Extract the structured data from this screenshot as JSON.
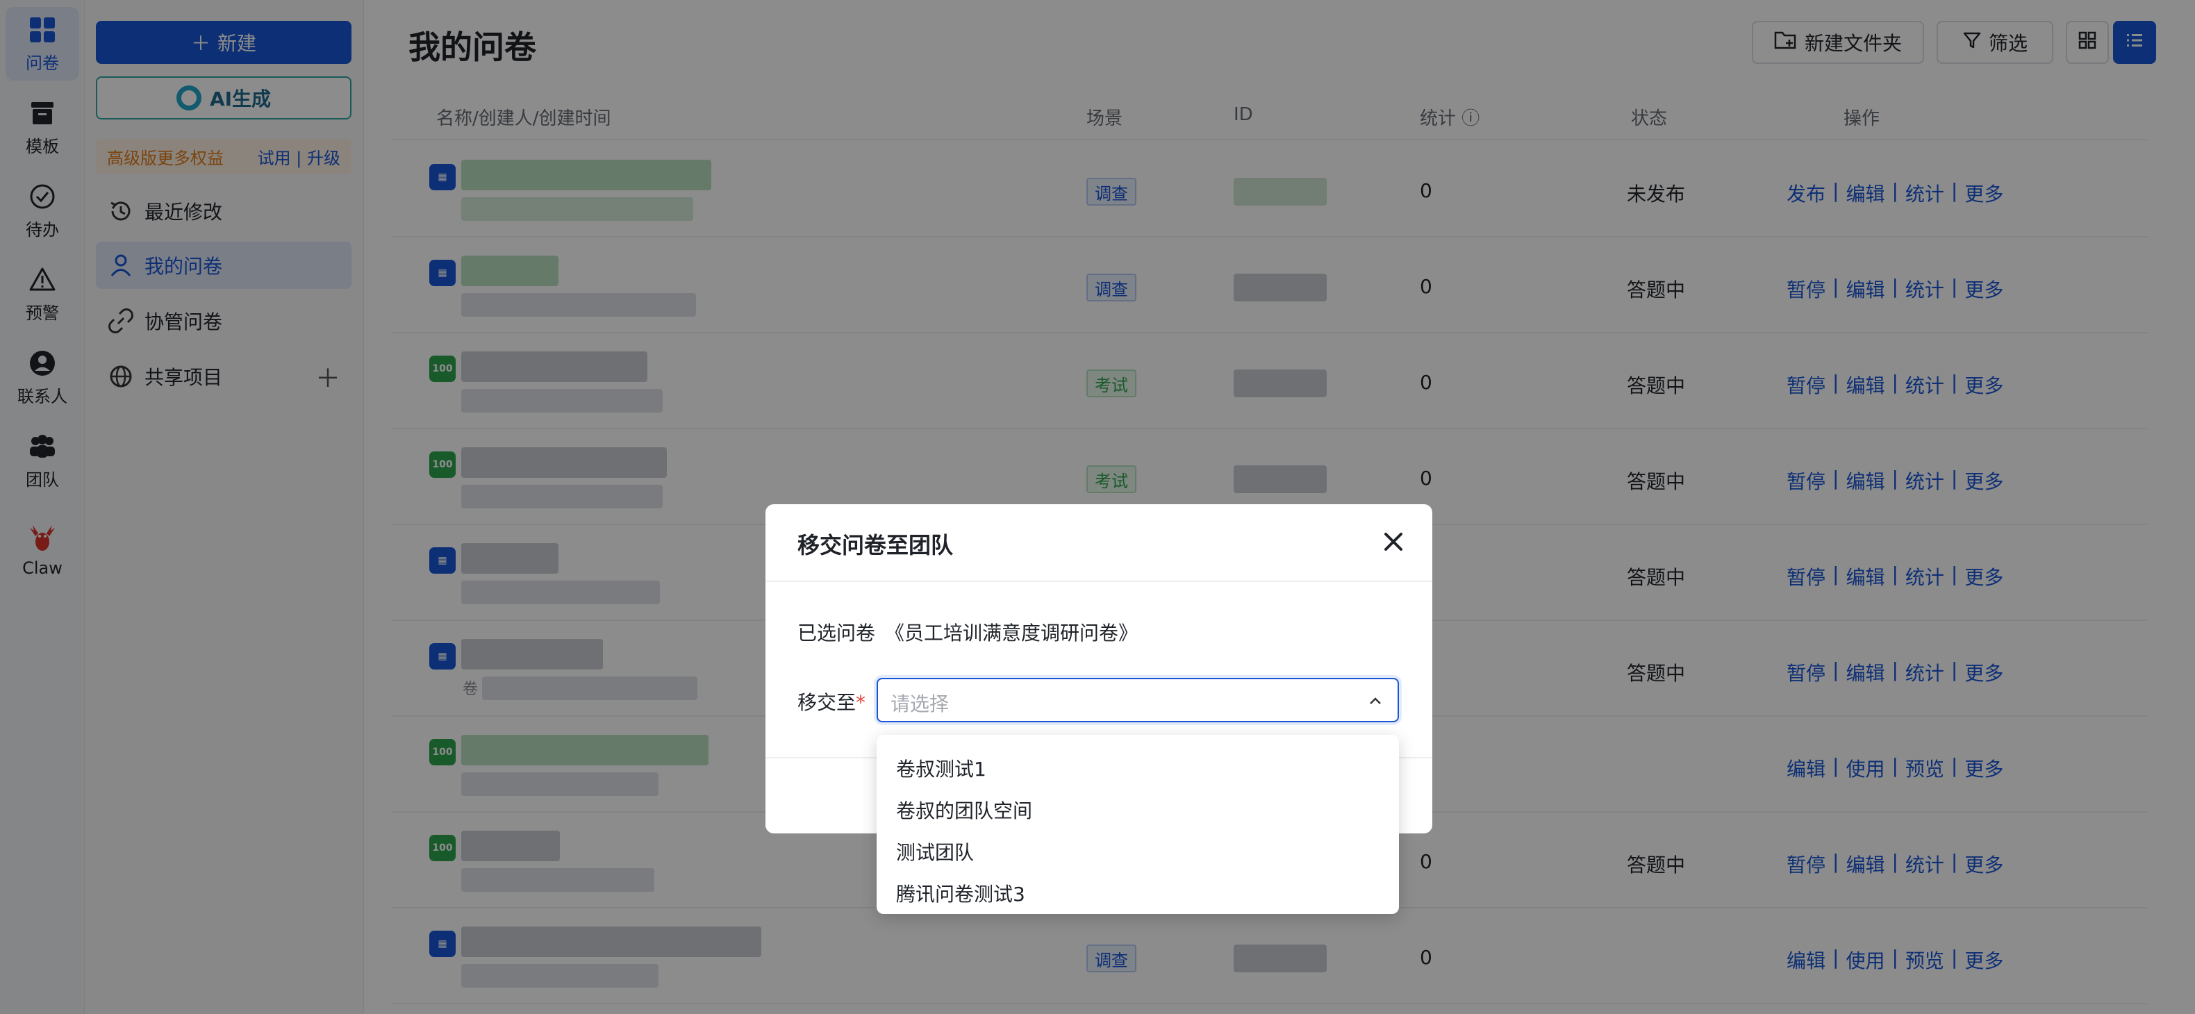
{
  "rail": {
    "items": [
      {
        "label": "问卷",
        "icon": "grid-icon",
        "active": true
      },
      {
        "label": "模板",
        "icon": "archive-icon"
      },
      {
        "label": "待办",
        "icon": "check-circle-icon"
      },
      {
        "label": "预警",
        "icon": "warning-icon"
      },
      {
        "label": "联系人",
        "icon": "contact-icon"
      },
      {
        "label": "团队",
        "icon": "team-icon"
      },
      {
        "label": "Claw",
        "icon": "claw-icon"
      }
    ]
  },
  "sidebar": {
    "new_label": "新建",
    "ai_label": "AI生成",
    "promo_text": "高级版更多权益",
    "promo_links": "试用 | 升级",
    "nav": [
      {
        "label": "最近修改",
        "icon": "history-icon"
      },
      {
        "label": "我的问卷",
        "icon": "user-icon",
        "active": true
      },
      {
        "label": "协管问卷",
        "icon": "link-icon"
      },
      {
        "label": "共享项目",
        "icon": "globe-icon"
      }
    ]
  },
  "main": {
    "title": "我的问卷",
    "toolbar": {
      "new_folder_label": "新建文件夹",
      "filter_label": "筛选"
    },
    "table": {
      "headers": {
        "name": "名称/创建人/创建时间",
        "scene": "场景",
        "id": "ID",
        "stats": "统计",
        "status": "状态",
        "ops": "操作"
      },
      "rows": [
        {
          "type": "survey",
          "scene": "调查",
          "count": "0",
          "status": "未发布",
          "ops": [
            "发布",
            "编辑",
            "统计",
            "更多"
          ],
          "partial": ""
        },
        {
          "type": "survey",
          "scene": "调查",
          "count": "0",
          "status": "答题中",
          "ops": [
            "暂停",
            "编辑",
            "统计",
            "更多"
          ],
          "partial": ""
        },
        {
          "type": "exam",
          "scene": "考试",
          "count": "0",
          "status": "答题中",
          "ops": [
            "暂停",
            "编辑",
            "统计",
            "更多"
          ],
          "partial": ""
        },
        {
          "type": "exam",
          "scene": "考试",
          "count": "0",
          "status": "答题中",
          "ops": [
            "暂停",
            "编辑",
            "统计",
            "更多"
          ],
          "partial": ""
        },
        {
          "type": "survey",
          "scene": "",
          "count": "",
          "status": "答题中",
          "ops": [
            "暂停",
            "编辑",
            "统计",
            "更多"
          ],
          "partial": ""
        },
        {
          "type": "survey",
          "scene": "",
          "count": "",
          "status": "答题中",
          "ops": [
            "暂停",
            "编辑",
            "统计",
            "更多"
          ],
          "partial": "卷"
        },
        {
          "type": "exam",
          "scene": "",
          "count": "",
          "status": "",
          "ops": [
            "编辑",
            "使用",
            "预览",
            "更多"
          ],
          "partial": ""
        },
        {
          "type": "exam",
          "scene": "",
          "count": "0",
          "status": "答题中",
          "ops": [
            "暂停",
            "编辑",
            "统计",
            "更多"
          ],
          "partial": ""
        },
        {
          "type": "survey",
          "scene": "调查",
          "count": "0",
          "status": "",
          "ops": [
            "编辑",
            "使用",
            "预览",
            "更多"
          ],
          "partial": ""
        }
      ]
    }
  },
  "modal": {
    "title": "移交问卷至团队",
    "selected_label": "已选问卷",
    "selected_name": "《员工培训满意度调研问卷》",
    "move_label": "移交至",
    "required_mark": "*",
    "select_placeholder": "请选择",
    "options": [
      "卷叔测试1",
      "卷叔的团队空间",
      "测试团队",
      "腾讯问卷测试3"
    ]
  }
}
